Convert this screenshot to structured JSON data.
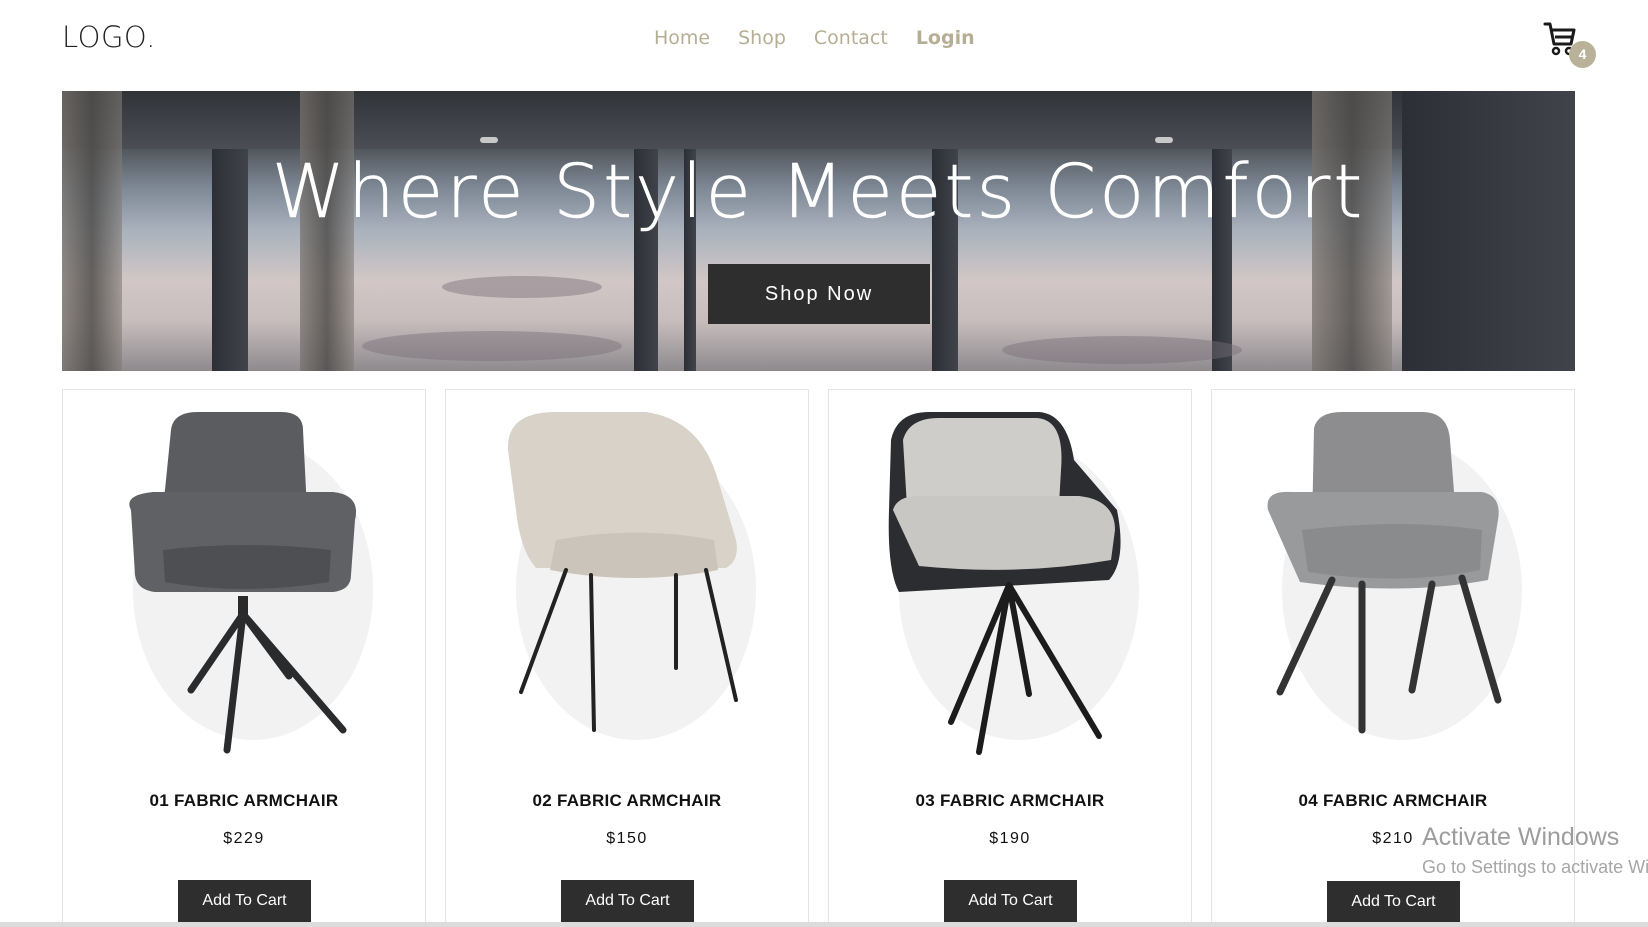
{
  "header": {
    "logo": "LOGO.",
    "nav": [
      {
        "label": "Home"
      },
      {
        "label": "Shop"
      },
      {
        "label": "Contact"
      },
      {
        "label": "Login"
      }
    ],
    "cart_icon": "cart-icon",
    "cart_count": "4"
  },
  "hero": {
    "title": "Where Style Meets Comfort",
    "button_label": "Shop Now"
  },
  "products": [
    {
      "name": "01 FABRIC ARMCHAIR",
      "price": "$229",
      "button_label": "Add To Cart"
    },
    {
      "name": "02 FABRIC ARMCHAIR",
      "price": "$150",
      "button_label": "Add To Cart"
    },
    {
      "name": "03 FABRIC ARMCHAIR",
      "price": "$190",
      "button_label": "Add To Cart"
    },
    {
      "name": "04 FABRIC ARMCHAIR",
      "price": "$210",
      "button_label": "Add To Cart"
    }
  ],
  "watermark": {
    "line1": "Activate Windows",
    "line2": "Go to Settings to activate Wi"
  },
  "colors": {
    "accent": "#b5ae94",
    "button": "#2e2e2e",
    "badge": "#b9b298"
  }
}
